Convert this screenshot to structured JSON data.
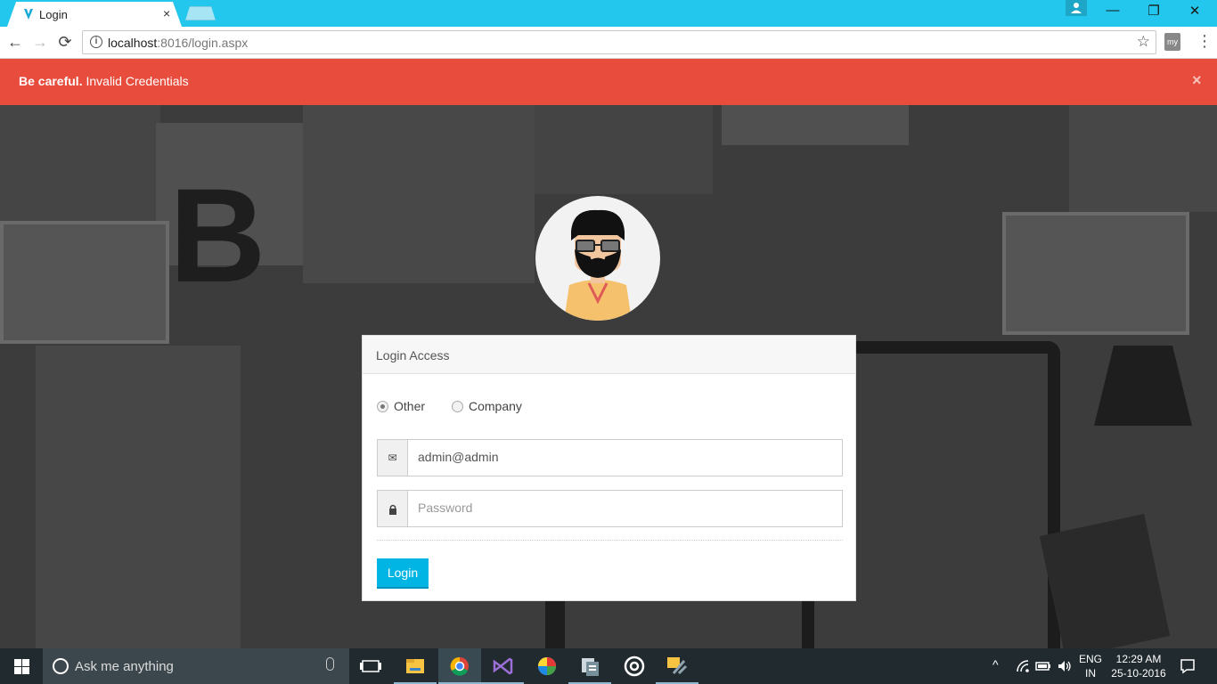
{
  "browser": {
    "tab_title": "Login",
    "tab_close": "×",
    "url_host": "localhost",
    "url_rest": ":8016/login.aspx",
    "window_controls": {
      "minimize": "—",
      "maximize": "❐",
      "close": "✕"
    },
    "extension_label": "my"
  },
  "alert": {
    "strong": "Be careful.",
    "message": "Invalid Credentials",
    "close": "×",
    "color": "#e74c3c"
  },
  "login": {
    "heading": "Login Access",
    "radio_options": [
      {
        "label": "Other",
        "checked": true
      },
      {
        "label": "Company",
        "checked": false
      }
    ],
    "email_value": "admin@admin",
    "password_placeholder": "Password",
    "submit_label": "Login",
    "button_color": "#00b4e4"
  },
  "taskbar": {
    "search_placeholder": "Ask me anything",
    "lang_line1": "ENG",
    "lang_line2": "IN",
    "time": "12:29 AM",
    "date": "25-10-2016"
  },
  "icons": {
    "start": "windows-logo-icon",
    "search": "cortana-icon",
    "mic": "microphone-icon",
    "email_addon": "envelope-icon",
    "password_addon": "lock-icon"
  }
}
